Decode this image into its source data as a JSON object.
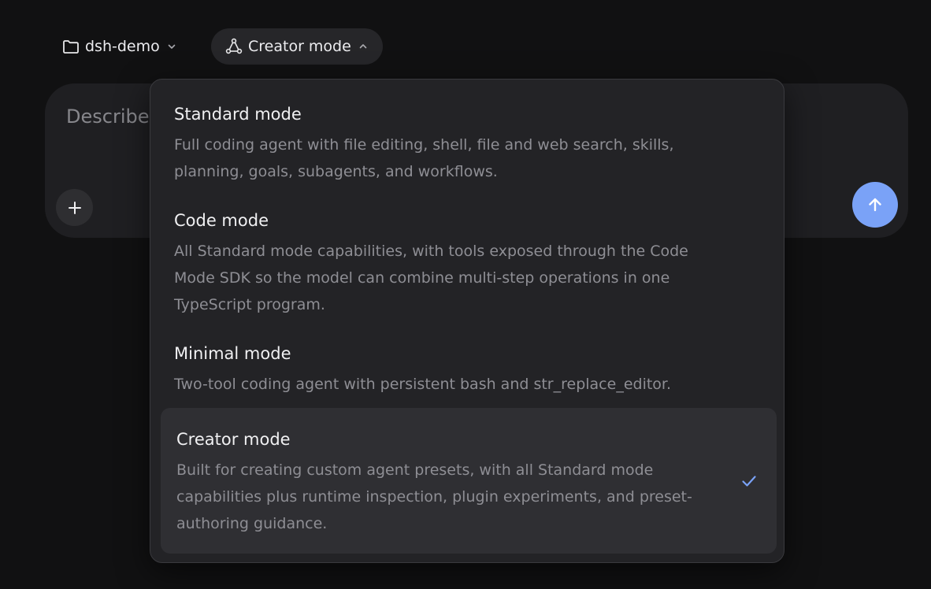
{
  "topbar": {
    "project_label": "dsh-demo",
    "project_icon": "folder-icon",
    "mode_label": "Creator mode",
    "mode_icon": "nodes-icon"
  },
  "composer": {
    "placeholder_visible": "Describe",
    "add_icon": "plus-icon",
    "send_icon": "arrow-up-icon"
  },
  "mode_menu": {
    "selected": "Creator mode",
    "options": [
      {
        "title": "Standard mode",
        "description": "Full coding agent with file editing, shell, file and web search, skills, planning, goals, subagents, and workflows."
      },
      {
        "title": "Code mode",
        "description": "All Standard mode capabilities, with tools exposed through the Code Mode SDK so the model can combine multi-step operations in one TypeScript program."
      },
      {
        "title": "Minimal mode",
        "description": "Two-tool coding agent with persistent bash and str_replace_editor."
      },
      {
        "title": "Creator mode",
        "description": "Built for creating custom agent presets, with all Standard mode capabilities plus runtime inspection, plugin experiments, and preset-authoring guidance."
      }
    ]
  },
  "colors": {
    "background": "#111112",
    "accent": "#7aa2f7",
    "menu_bg": "#232326",
    "selected_bg": "#2f2f33"
  }
}
